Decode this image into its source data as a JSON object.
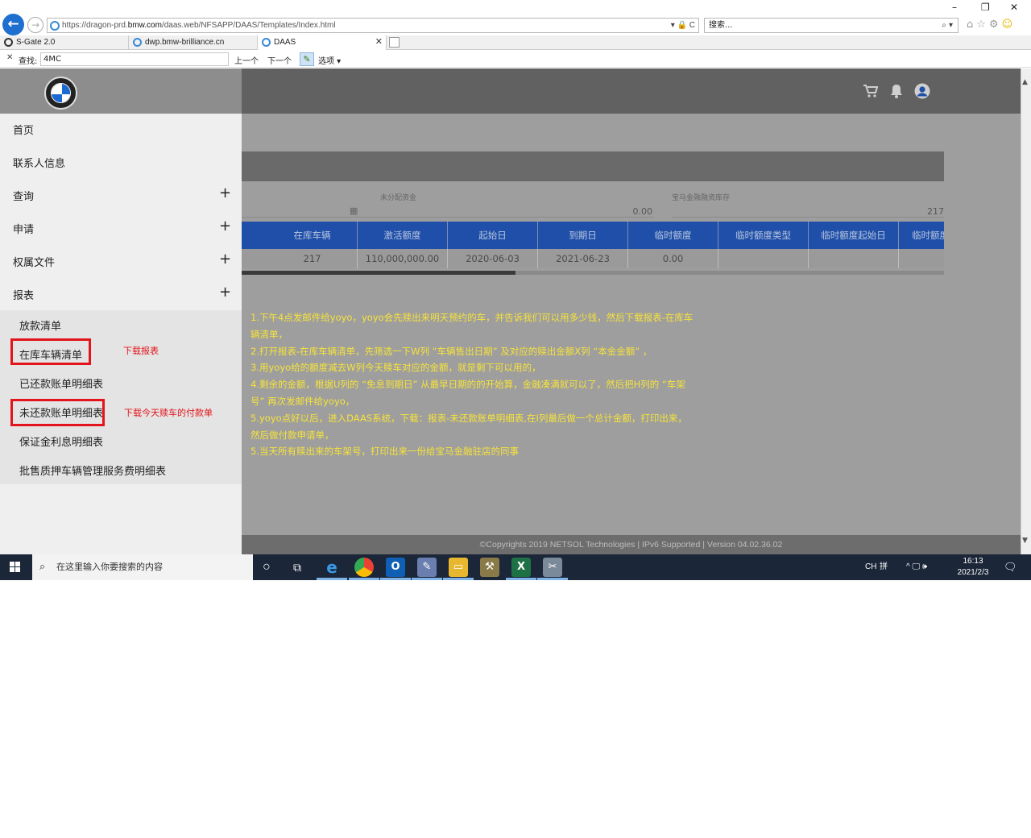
{
  "browser": {
    "url_prefix": "https://dragon-prd.",
    "url_host": "bmw.com",
    "url_path": "/daas.web/NFSAPP/DAAS/Templates/Index.html",
    "url_controls": "▾ 🔒 C",
    "search_placeholder": "搜索...",
    "search_icon_glyph": "⌕ ▾",
    "win_min": "–",
    "win_restore": "❐",
    "win_close": "✕",
    "tabs": [
      {
        "label": "S-Gate 2.0"
      },
      {
        "label": "dwp.bmw-brilliance.cn"
      },
      {
        "label": "DAAS"
      }
    ],
    "tab_close": "✕",
    "find": {
      "close": "✕",
      "label": "查找:",
      "value": "4MC",
      "prev": "上一个",
      "next": "下一个",
      "options": "选项"
    }
  },
  "sidebar": {
    "menu": [
      {
        "label": "首页",
        "expandable": false
      },
      {
        "label": "联系人信息",
        "expandable": false
      },
      {
        "label": "查询",
        "expandable": true
      },
      {
        "label": "申请",
        "expandable": true
      },
      {
        "label": "权属文件",
        "expandable": true
      },
      {
        "label": "报表",
        "expandable": true
      }
    ],
    "plus": "+",
    "submenu": [
      {
        "label": "放款清单"
      },
      {
        "label": "在库车辆清单"
      },
      {
        "label": "已还款账单明细表"
      },
      {
        "label": "未还款账单明细表"
      },
      {
        "label": "保证金利息明细表"
      },
      {
        "label": "批售质押车辆管理服务费明细表"
      }
    ]
  },
  "annotations": {
    "download_report": "下载报表",
    "download_today": "下载今天赎车的付款单",
    "color": "#e3141b"
  },
  "fields": {
    "unallocated_label": "未分配资金",
    "unallocated_value": "0.00",
    "inventory_label": "宝马金融融资库存",
    "inventory_value": "217"
  },
  "grid": {
    "headers": [
      "在库车辆",
      "激活额度",
      "起始日",
      "到期日",
      "临时额度",
      "临时额度类型",
      "临时额度起始日",
      "临时额度"
    ],
    "row": [
      "217",
      "110,000,000.00",
      "2020-06-03",
      "2021-06-23",
      "0.00",
      "",
      "",
      ""
    ]
  },
  "instructions": [
    "1.下午4点发邮件给yoyo，yoyo会先赎出来明天预约的车，并告诉我们可以用多少钱，然后下载报表-在库车",
    "辆清单，",
    "2.打开报表-在库车辆清单，先筛选一下W列 “车辆售出日期” 及对应的赎出金额X列 “本金金额” ，",
    "3.用yoyo给的额度减去W列今天赎车对应的金额，就是剩下可以用的，",
    "4.剩余的金额，根据U列的 “免息到期日” 从最早日期的的开始算，金融凑满就可以了，然后把H列的 “车架",
    "号” 再次发邮件给yoyo，",
    "5.yoyo点好以后，进入DAAS系统，下载：报表-未还款账单明细表,在I列最后做一个总计金额，打印出来，",
    "然后做付款申请单，",
    "5.当天所有赎出来的车架号，打印出来一份给宝马金融驻店的同事"
  ],
  "footer": "©Copyrights 2019 NETSOL Technologies | IPv6 Supported | Version 04.02.36.02",
  "taskbar": {
    "search_placeholder": "在这里输入你要搜索的内容",
    "search_icon_glyph": "⌕",
    "cortana_glyph": "○",
    "taskview_glyph": "⧉",
    "ime": "CH",
    "ime_mode": "拼",
    "tray_icons": "^ 🖵 🕪",
    "notification_glyph": "🗨",
    "time": "16:13",
    "date": "2021/2/3"
  },
  "colors": {
    "grid_header_bg": "#1f4fa8",
    "instruction_text": "#f7e33a",
    "back_button": "#1e6fcf"
  }
}
